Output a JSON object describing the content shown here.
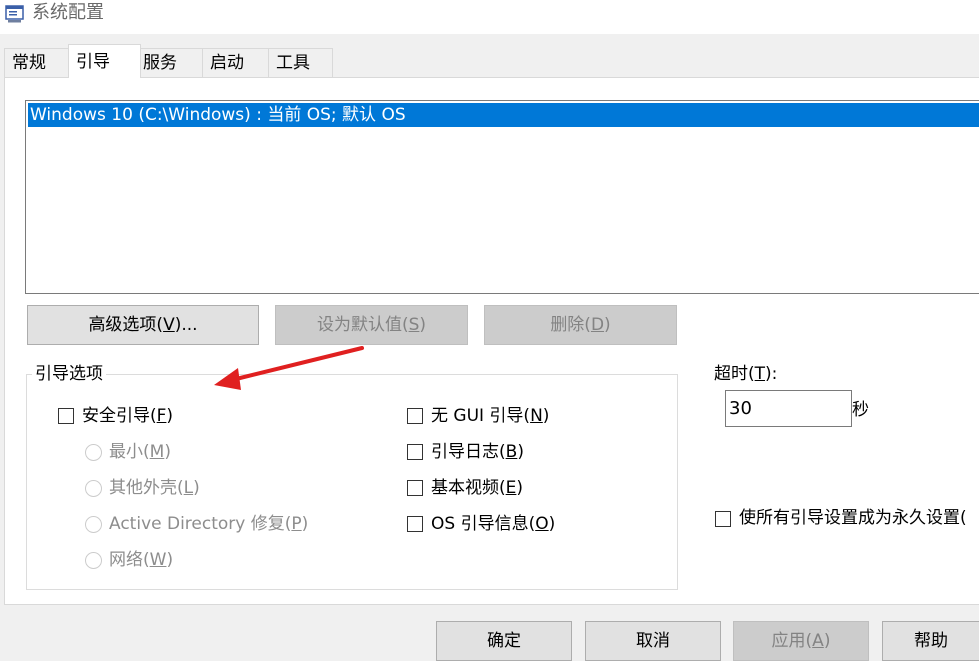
{
  "window": {
    "title": "系统配置"
  },
  "tabs": [
    {
      "label": "常规"
    },
    {
      "label": "引导"
    },
    {
      "label": "服务"
    },
    {
      "label": "启动"
    },
    {
      "label": "工具"
    }
  ],
  "boot_list": {
    "items": [
      "Windows 10 (C:\\Windows) : 当前 OS; 默认 OS"
    ]
  },
  "buttons": {
    "advanced": {
      "text": "高级选项(",
      "key": "V",
      "suffix": ")..."
    },
    "set_default": {
      "text": "设为默认值(",
      "key": "S",
      "suffix": ")"
    },
    "delete": {
      "text": "删除(",
      "key": "D",
      "suffix": ")"
    }
  },
  "boot_options": {
    "title": "引导选项",
    "safe_boot": {
      "text": "安全引导(",
      "key": "F",
      "suffix": ")"
    },
    "minimal": {
      "text": "最小(",
      "key": "M",
      "suffix": ")"
    },
    "alternate_shell": {
      "text": "其他外壳(",
      "key": "L",
      "suffix": ")"
    },
    "ad_repair": {
      "text": "Active Directory 修复(",
      "key": "P",
      "suffix": ")"
    },
    "network": {
      "text": "网络(",
      "key": "W",
      "suffix": ")"
    },
    "no_gui": {
      "text": "无 GUI 引导(",
      "key": "N",
      "suffix": ")"
    },
    "boot_log": {
      "text": "引导日志(",
      "key": "B",
      "suffix": ")"
    },
    "base_video": {
      "text": "基本视频(",
      "key": "E",
      "suffix": ")"
    },
    "os_boot_info": {
      "text": "OS 引导信息(",
      "key": "O",
      "suffix": ")"
    }
  },
  "timeout": {
    "text": "超时(",
    "key": "T",
    "suffix": "):",
    "value": "30",
    "unit": "秒"
  },
  "permanent": {
    "label": "使所有引导设置成为永久设置("
  },
  "dialog_buttons": {
    "ok": "确定",
    "cancel": "取消",
    "apply": {
      "text": "应用(",
      "key": "A",
      "suffix": ")"
    },
    "help": "帮助"
  },
  "colors": {
    "selection": "#0078d7",
    "annotation_arrow": "#e02020"
  }
}
